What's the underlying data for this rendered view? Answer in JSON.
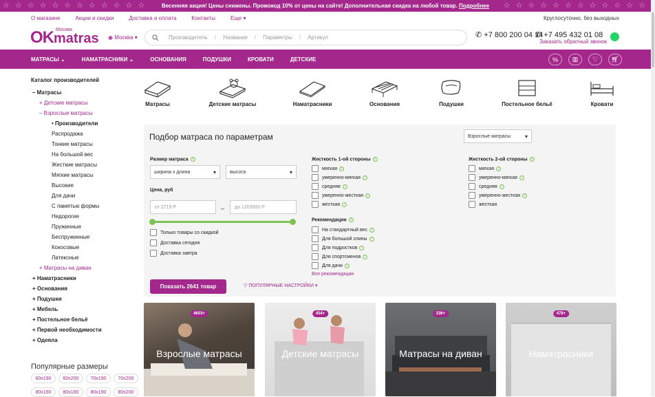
{
  "promo": {
    "text": "Весенняя акция! Цены снижены. Промокод 10% от цены на сайте! Дополнительная скидка на любой товар.",
    "link": "Подробнее"
  },
  "toplinks": [
    "О магазине",
    "Акции и скидки",
    "Доставка и оплата",
    "Контакты",
    "Еще"
  ],
  "hours": "Круглосуточно, без выходных",
  "logo": {
    "ok": "OK",
    "brand": "matras",
    "city": "Москва"
  },
  "city": "Москва",
  "search": {
    "placeholders": [
      "Производитель",
      "Название",
      "Параметры",
      "Артикул"
    ]
  },
  "phones": {
    "p1": "+7 800 200 04 14",
    "p2": "+7 495 432 01 08",
    "callback": "Заказать обратный звонок"
  },
  "nav": [
    "МАТРАСЫ",
    "НАМАТРАСНИКИ",
    "ОСНОВАНИЯ",
    "ПОДУШКИ",
    "КРОВАТИ",
    "ДЕТСКИЕ"
  ],
  "nav_icons": [
    "percent-icon",
    "chart-icon",
    "heart-icon",
    "cart-icon"
  ],
  "catalog": {
    "title": "Каталог производителей",
    "items": [
      {
        "t": "– Матрасы",
        "lvl": 1,
        "bold": true,
        "pur": false
      },
      {
        "t": "+ Детские матрасы",
        "lvl": 2,
        "bold": false,
        "pur": true
      },
      {
        "t": "– Взрослые матрасы",
        "lvl": 2,
        "bold": false,
        "pur": true
      },
      {
        "t": "• Производители",
        "lvl": 3,
        "bold": true,
        "pur": false
      },
      {
        "t": "Распродажа",
        "lvl": 3,
        "bold": false,
        "pur": false
      },
      {
        "t": "Тонкие матрасы",
        "lvl": 3,
        "bold": false,
        "pur": false
      },
      {
        "t": "На большой вес",
        "lvl": 3,
        "bold": false,
        "pur": false
      },
      {
        "t": "Жесткие матрасы",
        "lvl": 3,
        "bold": false,
        "pur": false
      },
      {
        "t": "Мягкие матрасы",
        "lvl": 3,
        "bold": false,
        "pur": false
      },
      {
        "t": "Высокие",
        "lvl": 3,
        "bold": false,
        "pur": false
      },
      {
        "t": "Для дачи",
        "lvl": 3,
        "bold": false,
        "pur": false
      },
      {
        "t": "С памятью формы",
        "lvl": 3,
        "bold": false,
        "pur": false
      },
      {
        "t": "Недорогие",
        "lvl": 3,
        "bold": false,
        "pur": false
      },
      {
        "t": "Пружинные",
        "lvl": 3,
        "bold": false,
        "pur": false
      },
      {
        "t": "Беспружинные",
        "lvl": 3,
        "bold": false,
        "pur": false
      },
      {
        "t": "Кокосовые",
        "lvl": 3,
        "bold": false,
        "pur": false
      },
      {
        "t": "Латексные",
        "lvl": 3,
        "bold": false,
        "pur": false
      },
      {
        "t": "+ Матрасы на диван",
        "lvl": 2,
        "bold": false,
        "pur": true
      },
      {
        "t": "+ Наматрасники",
        "lvl": 1,
        "bold": true,
        "pur": false
      },
      {
        "t": "+ Основания",
        "lvl": 1,
        "bold": true,
        "pur": false
      },
      {
        "t": "+ Подушки",
        "lvl": 1,
        "bold": true,
        "pur": false
      },
      {
        "t": "+ Мебель",
        "lvl": 1,
        "bold": true,
        "pur": false
      },
      {
        "t": "+ Постельное бельё",
        "lvl": 1,
        "bold": true,
        "pur": false
      },
      {
        "t": "+ Первой необходимости",
        "lvl": 1,
        "bold": true,
        "pur": false
      },
      {
        "t": "+ Одеяла",
        "lvl": 1,
        "bold": true,
        "pur": false
      }
    ]
  },
  "popular": {
    "title": "Популярные размеры",
    "sizes": [
      "60x190",
      "60x200",
      "70x190",
      "70x200",
      "80x160",
      "80x180",
      "80x190",
      "80x200"
    ]
  },
  "categories": [
    "Матрасы",
    "Детские матрасы",
    "Наматрасники",
    "Основания",
    "Подушки",
    "Постельное бельё",
    "Кровати"
  ],
  "filter": {
    "title": "Подбор матраса по параметрам",
    "type_select": "Взрослые матрасы",
    "size_label": "Размер матраса",
    "size_select": "ширина х длина",
    "height_select": "высота",
    "price_label": "Цена, руб",
    "price_from": "от  2719 Р",
    "price_to": "до  1203000 Р",
    "price_dash": "–",
    "checks": [
      "Только товары со скидкой",
      "Доставка сегодня",
      "Доставка завтра"
    ],
    "hard1_label": "Жесткость 1-ой стороны",
    "hard1": [
      "мягкая",
      "умеренно-мягкая",
      "средняя",
      "умеренно-жесткая",
      "жесткая"
    ],
    "hard2_label": "Жесткость 2-ой стороны",
    "hard2": [
      "мягкая",
      "умеренно-мягкая",
      "средняя",
      "умеренно-жесткая",
      "жесткая"
    ],
    "rec_label": "Рекомендации",
    "rec": [
      "На стандартный вес",
      "Для большой спины",
      "Для подростков",
      "Для спортсменов",
      "Для дачи"
    ],
    "more_rec": "Все рекомендации",
    "show_button": "Показать 2641 товар",
    "popular_settings": "ПОПУЛЯРНЫЕ НАСТРОЙКИ"
  },
  "cards": [
    {
      "count": "4603+",
      "title": "Взрослые матрасы"
    },
    {
      "count": "454+",
      "title": "Детские матрасы"
    },
    {
      "count": "236+",
      "title": "Матрасы на диван"
    },
    {
      "count": "478+",
      "title": "Наматрасники"
    }
  ],
  "colors": {
    "brand": "#a4278c",
    "green": "#7cc254"
  }
}
